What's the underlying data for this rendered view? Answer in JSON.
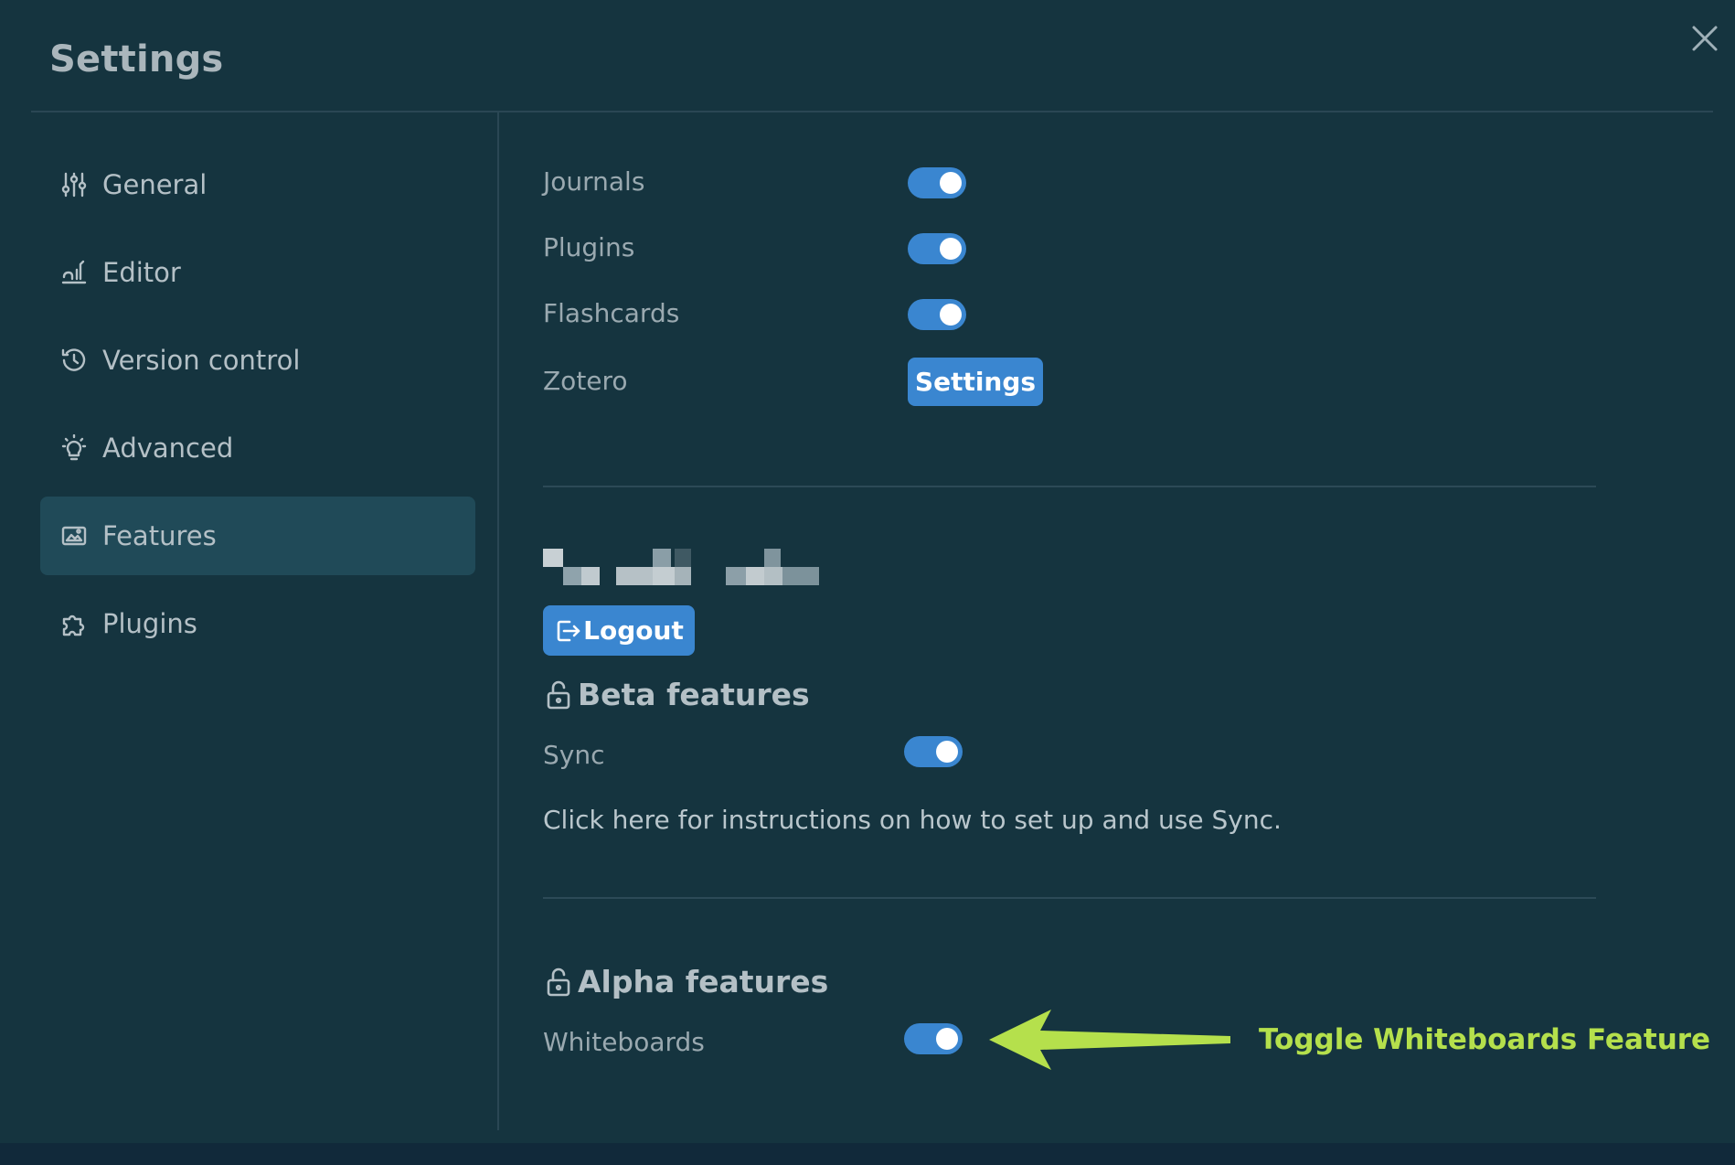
{
  "window": {
    "title": "Settings",
    "close_icon": "close-icon"
  },
  "sidebar": {
    "items": [
      {
        "label": "General",
        "icon": "sliders-icon"
      },
      {
        "label": "Editor",
        "icon": "editor-icon"
      },
      {
        "label": "Version control",
        "icon": "history-icon"
      },
      {
        "label": "Advanced",
        "icon": "bulb-icon"
      },
      {
        "label": "Features",
        "icon": "image-frame-icon",
        "active": true
      },
      {
        "label": "Plugins",
        "icon": "puzzle-icon"
      }
    ]
  },
  "features": {
    "journals_label": "Journals",
    "journals_on": true,
    "plugins_label": "Plugins",
    "plugins_on": true,
    "flashcards_label": "Flashcards",
    "flashcards_on": true,
    "zotero_label": "Zotero",
    "zotero_button": "Settings"
  },
  "account": {
    "logout_button": "Logout",
    "logout_icon": "logout-icon"
  },
  "beta": {
    "heading": "Beta features",
    "heading_icon": "unlock-icon",
    "sync_label": "Sync",
    "sync_on": true,
    "sync_help_link": "Click here for instructions on how to set up and use Sync."
  },
  "alpha": {
    "heading": "Alpha features",
    "heading_icon": "unlock-icon",
    "whiteboards_label": "Whiteboards",
    "whiteboards_on": true
  },
  "annotation": {
    "text": "Toggle Whiteboards Feature",
    "arrow_icon": "arrow-left-icon",
    "color": "#b5e04c"
  },
  "colors": {
    "background": "#15343f",
    "accent": "#3a86d0",
    "active_nav": "#204a58"
  }
}
